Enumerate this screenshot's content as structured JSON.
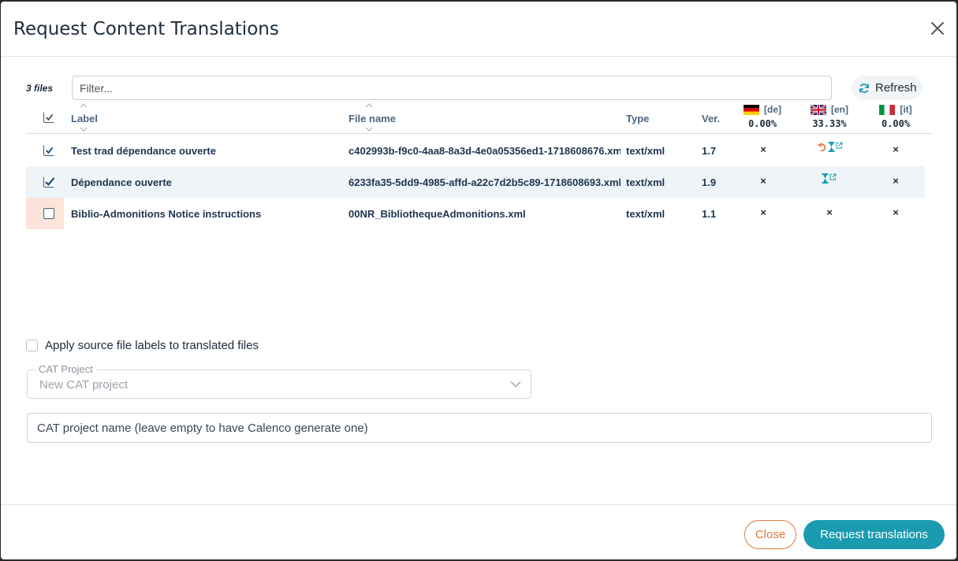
{
  "dialog": {
    "title": "Request Content Translations"
  },
  "toolbar": {
    "files_count": "3 files",
    "filter_placeholder": "Filter...",
    "refresh_label": "Refresh"
  },
  "table": {
    "columns": {
      "label": "Label",
      "file_name": "File name",
      "type": "Type",
      "version": "Ver."
    },
    "languages": [
      {
        "code": "[de]",
        "percent": "0.00%",
        "flag": "flag-de-icon"
      },
      {
        "code": "[en]",
        "percent": "33.33%",
        "flag": "flag-gb-icon"
      },
      {
        "code": "[it]",
        "percent": "0.00%",
        "flag": "flag-it-icon"
      }
    ],
    "rows": [
      {
        "checked": true,
        "label": "Test trad dépendance ouverte",
        "file_name": "c402993b-f9c0-4aa8-8a3d-4e0a05356ed1-1718608676.xm",
        "type": "text/xml",
        "version": "1.7",
        "status": [
          "×",
          "undo-hourglass-link",
          "×"
        ]
      },
      {
        "checked": true,
        "label": "Dépendance ouverte",
        "file_name": "6233fa35-5dd9-4985-affd-a22c7d2b5c89-1718608693.xml",
        "type": "text/xml",
        "version": "1.9",
        "status": [
          "×",
          "hourglass-link",
          "×"
        ]
      },
      {
        "checked": false,
        "label": "Biblio-Admonitions Notice instructions",
        "file_name": "00NR_BibliothequeAdmonitions.xml",
        "type": "text/xml",
        "version": "1.1",
        "status": [
          "×",
          "×",
          "×"
        ]
      }
    ]
  },
  "options": {
    "apply_labels": "Apply source file labels to translated files",
    "cat_project_legend": "CAT Project",
    "cat_project_value": "New CAT project",
    "cat_name_placeholder": "CAT project name (leave empty to have Calenco generate one)"
  },
  "footer": {
    "close_label": "Close",
    "request_label": "Request translations"
  },
  "colors": {
    "accent": "#1a9bb0",
    "close_orange": "#e07a3d",
    "pending_orange": "#e07a3d",
    "pending_teal": "#1a9bb0"
  }
}
